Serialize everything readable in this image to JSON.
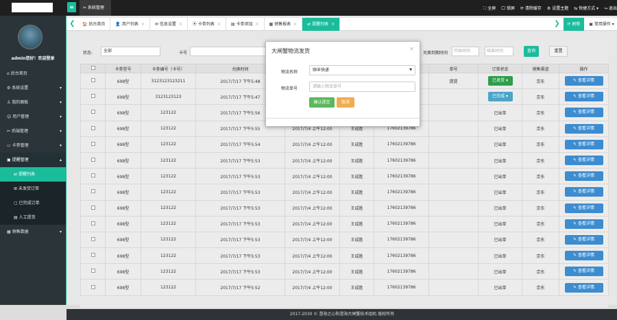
{
  "topbar": {
    "module": "✂ 系统管理",
    "actions": [
      "⛶ 全屏",
      "🖵 锁屏",
      "⟳ 清除缓存",
      "⚙ 设置主题",
      "⇆ 快捷方式 ▾",
      "↪ 退出"
    ]
  },
  "sidebar": {
    "greeting": "admin您好！欢迎登录",
    "items": [
      {
        "label": "后台首页",
        "icon": "home-icon",
        "arrow": ""
      },
      {
        "label": "系统设置",
        "icon": "gear-icon",
        "arrow": "▾"
      },
      {
        "label": "我的面板",
        "icon": "user-icon",
        "arrow": "▾"
      },
      {
        "label": "用户管理",
        "icon": "users-icon",
        "arrow": "▾"
      },
      {
        "label": "后端管理",
        "icon": "wrench-icon",
        "arrow": "▾"
      },
      {
        "label": "卡劵管理",
        "icon": "card-icon",
        "arrow": "▾"
      },
      {
        "label": "提醒管理",
        "icon": "bell-icon",
        "arrow": "▴"
      }
    ],
    "subitems": [
      "提醒列表",
      "未发货订单",
      "已完成订单",
      "人工提货"
    ],
    "last": {
      "label": "销售数据",
      "arrow": "▾"
    }
  },
  "tabs": [
    {
      "label": "后台首页",
      "icon": "🏠"
    },
    {
      "label": "用户列表",
      "icon": "👤"
    },
    {
      "label": "信息设置",
      "icon": "✉"
    },
    {
      "label": "卡劵列表",
      "icon": "⦿"
    },
    {
      "label": "卡劵添加",
      "icon": "▤"
    },
    {
      "label": "销售报表",
      "icon": "▦"
    },
    {
      "label": "提醒列表",
      "icon": "⇄"
    }
  ],
  "tabbar": {
    "prev": "❮",
    "next": "❯",
    "refresh": "⟳ 刷新",
    "ops": "▣ 常用操作 ▾",
    "close": "×"
  },
  "filter": {
    "status_label": "状态:",
    "status_value": "全部",
    "card_label": "卡号",
    "date_label": "兑换到期时间",
    "date_start": "开始时间",
    "date_end": "结束时间",
    "search": "查询",
    "reset": "重置"
  },
  "table": {
    "headers": [
      "",
      "卡劵型号",
      "卡劵编号（卡号）",
      "兑换时间",
      "",
      "",
      "",
      "单号",
      "订单状态",
      "销售渠道",
      "操作"
    ],
    "rows": [
      {
        "model": "698型",
        "code": "3123123123211",
        "time": "2017/7/17 下午5:48",
        "col4": "",
        "col5": "",
        "col6": "",
        "waybill": "提提",
        "status": "已发货 ▾",
        "status_btn": "green",
        "channel": "京东",
        "op": "✎ 查看详情"
      },
      {
        "model": "698型",
        "code": "3123123123",
        "time": "2017/7/17 下午5:47",
        "col4": "",
        "col5": "",
        "col6": "",
        "waybill": "",
        "status": "已完成 ▾",
        "status_btn": "blue",
        "channel": "京东",
        "op": "✎ 查看详情"
      },
      {
        "model": "698型",
        "code": "123122",
        "time": "2017/7/17 下午5:56",
        "col4": "",
        "col5": "",
        "col6": "",
        "waybill": "",
        "status": "已出单",
        "status_btn": "",
        "channel": "京东",
        "op": "✎ 查看详情"
      },
      {
        "model": "698型",
        "code": "123122",
        "time": "2017/7/17 下午5:55",
        "col4": "2017/7/4 上午12:00",
        "col5": "王成胜",
        "col6": "17602139786",
        "waybill": "",
        "status": "已出单",
        "status_btn": "",
        "channel": "京东",
        "op": "✎ 查看详情"
      },
      {
        "model": "698型",
        "code": "123122",
        "time": "2017/7/17 下午5:54",
        "col4": "2017/7/4 上午12:00",
        "col5": "王成胜",
        "col6": "17602139786",
        "waybill": "",
        "status": "已出单",
        "status_btn": "",
        "channel": "京东",
        "op": "✎ 查看详情"
      },
      {
        "model": "698型",
        "code": "123122",
        "time": "2017/7/17 下午5:53",
        "col4": "2017/7/4 上午12:00",
        "col5": "王成胜",
        "col6": "17602139786",
        "waybill": "",
        "status": "已出单",
        "status_btn": "",
        "channel": "京东",
        "op": "✎ 查看详情"
      },
      {
        "model": "698型",
        "code": "123122",
        "time": "2017/7/17 下午5:53",
        "col4": "2017/7/4 上午12:00",
        "col5": "王成胜",
        "col6": "17602139786",
        "waybill": "",
        "status": "已出单",
        "status_btn": "",
        "channel": "京东",
        "op": "✎ 查看详情"
      },
      {
        "model": "698型",
        "code": "123122",
        "time": "2017/7/17 下午5:53",
        "col4": "2017/7/4 上午12:00",
        "col5": "王成胜",
        "col6": "17602139786",
        "waybill": "",
        "status": "已出单",
        "status_btn": "",
        "channel": "京东",
        "op": "✎ 查看详情"
      },
      {
        "model": "698型",
        "code": "123122",
        "time": "2017/7/17 下午5:53",
        "col4": "2017/7/4 上午12:00",
        "col5": "王成胜",
        "col6": "17602139786",
        "waybill": "",
        "status": "已出单",
        "status_btn": "",
        "channel": "京东",
        "op": "✎ 查看详情"
      },
      {
        "model": "698型",
        "code": "123122",
        "time": "2017/7/17 下午5:53",
        "col4": "2017/7/4 上午12:00",
        "col5": "王成胜",
        "col6": "17602139786",
        "waybill": "",
        "status": "已出单",
        "status_btn": "",
        "channel": "京东",
        "op": "✎ 查看详情"
      },
      {
        "model": "698型",
        "code": "123122",
        "time": "2017/7/17 下午5:53",
        "col4": "2017/7/4 上午12:00",
        "col5": "王成胜",
        "col6": "17602139786",
        "waybill": "",
        "status": "已出单",
        "status_btn": "",
        "channel": "京东",
        "op": "✎ 查看详情"
      },
      {
        "model": "698型",
        "code": "123122",
        "time": "2017/7/17 下午5:53",
        "col4": "2017/7/4 上午12:00",
        "col5": "王成胜",
        "col6": "17602139786",
        "waybill": "",
        "status": "已出单",
        "status_btn": "",
        "channel": "京东",
        "op": "✎ 查看详情"
      },
      {
        "model": "698型",
        "code": "123122",
        "time": "2017/7/17 下午5:53",
        "col4": "2017/7/4 上午12:00",
        "col5": "王成胜",
        "col6": "17602139786",
        "waybill": "",
        "status": "已出单",
        "status_btn": "",
        "channel": "京东",
        "op": "✎ 查看详情"
      },
      {
        "model": "698型",
        "code": "123122",
        "time": "2017/7/17 下午5:52",
        "col4": "2017/7/4 上午12:00",
        "col5": "王成胜",
        "col6": "17602139786",
        "waybill": "",
        "status": "已出单",
        "status_btn": "",
        "channel": "京东",
        "op": "✎ 查看详情"
      }
    ]
  },
  "footer": "2017-2030 © 澄海之心和澄海大闸蟹技术组机 版权所有",
  "modal": {
    "title": "大闸蟹物流发货",
    "close": "×",
    "logistics_label": "物流名称",
    "logistics_value": "顺丰快递",
    "number_label": "物流单号",
    "number_placeholder": "请输入物流单号",
    "confirm": "确认提交",
    "cancel": "取消"
  },
  "colors": {
    "accent": "#1abc9c",
    "sidebar": "#2b3438",
    "detail_button": "#3d8ccf",
    "confirm": "#5cb85c",
    "cancel": "#f0ad4e"
  }
}
